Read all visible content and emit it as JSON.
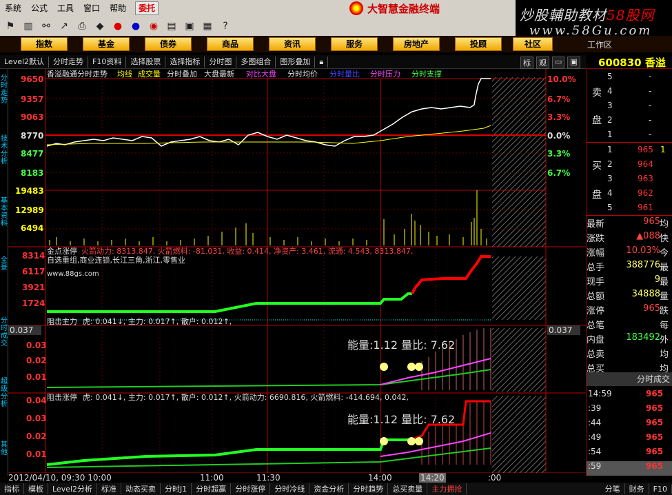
{
  "menu": {
    "items": [
      "系统",
      "公式",
      "工具",
      "窗口",
      "帮助"
    ],
    "special": "委托"
  },
  "brand": {
    "title": "大智慧金融终端"
  },
  "watermark": {
    "line1_a": "炒股輔助教材",
    "line1_b": "58股网",
    "line2": "www.58Gu.com"
  },
  "nav": {
    "buttons": [
      "指数",
      "基金",
      "债券",
      "商品",
      "资讯",
      "服务",
      "房地产",
      "投顾",
      "社区"
    ],
    "workzone": "工作区"
  },
  "subbar": {
    "items": [
      "Level2默认",
      "分时走势",
      "F10资料",
      "选择股票",
      "选择指标",
      "分时图",
      "多图组合",
      "图形叠加"
    ],
    "right": [
      "标",
      "观"
    ]
  },
  "stock": {
    "code": "600830",
    "name": "香溢"
  },
  "left_labels": [
    "分时走势",
    "技术分析",
    "基本资料",
    "全景",
    "分时成交",
    "超级分析",
    "其他"
  ],
  "main_chart": {
    "title": "香溢融通分时走势",
    "legend": [
      {
        "label": "均线",
        "color": "#ffff00"
      },
      {
        "label": "成交量",
        "color": "#ffff00"
      },
      {
        "label": "分时叠加",
        "color": "#dddddd"
      },
      {
        "label": "大盘最新",
        "color": "#dddddd"
      },
      {
        "label": "对比大盘",
        "color": "#ff44ff"
      },
      {
        "label": "分时均价",
        "color": "#dddddd"
      },
      {
        "label": "分时量比",
        "color": "#4444ff"
      },
      {
        "label": "分时压力",
        "color": "#ff44ff"
      },
      {
        "label": "分时支撑",
        "color": "#44ff44"
      }
    ],
    "y_left": [
      "9650",
      "9357",
      "9063",
      "8770",
      "8477",
      "8183"
    ],
    "y_right": [
      "10.0%",
      "6.7%",
      "3.3%",
      "0.0%",
      "3.3%",
      "6.7%"
    ],
    "vol_left": [
      "19483",
      "12989",
      "6494"
    ]
  },
  "panel2": {
    "title": "金点涨停",
    "fields": "火箭动力: 8313.847, 火箭燃料: -81.031, 收益: 0.414, 净资产: 3.461, 流通: 4.543, 8313.847,",
    "tags": "自选重组,商业连锁,长江三角,浙江,零售业",
    "url": "www.88gs.com",
    "y_left": [
      "8314",
      "6117",
      "3921",
      "1724"
    ]
  },
  "panel3": {
    "title": "阻击主力",
    "fields": "虎: 0.041↓, 主力: 0.017↑, 散户: 0.012↑,",
    "energy": "能量:1.12 量比: 7.62",
    "y_left": [
      "0.03",
      "0.02",
      "0.01"
    ],
    "badge": "0.037"
  },
  "panel4": {
    "title": "阻击涨停",
    "fields": "虎: 0.041↓, 主力: 0.017↑, 散户: 0.012↑, 火箭动力: 6690.816, 火箭燃料: -414.694, 0.042,",
    "energy": "能量:1.12 量比: 7.62",
    "y_left": [
      "0.04",
      "0.03",
      "0.02",
      "0.01"
    ]
  },
  "time_axis": [
    "2012/04/10, 09:30 10:00",
    "11:00",
    "11:30",
    "14:00",
    "14:20",
    ":00"
  ],
  "orderbook": {
    "sell_label": [
      "卖",
      "盘"
    ],
    "buy_label": [
      "买",
      "盘"
    ],
    "sell": [
      {
        "level": "5",
        "price": "",
        "vol": "-"
      },
      {
        "level": "4",
        "price": "",
        "vol": "-"
      },
      {
        "level": "3",
        "price": "",
        "vol": "-"
      },
      {
        "level": "2",
        "price": "",
        "vol": "-"
      },
      {
        "level": "1",
        "price": "",
        "vol": "-"
      }
    ],
    "buy": [
      {
        "level": "1",
        "price": "965",
        "tail": "1"
      },
      {
        "level": "2",
        "price": "964",
        "tail": ""
      },
      {
        "level": "3",
        "price": "963",
        "tail": ""
      },
      {
        "level": "4",
        "price": "962",
        "tail": ""
      },
      {
        "level": "5",
        "price": "961",
        "tail": ""
      }
    ]
  },
  "quote": [
    {
      "label": "最新",
      "value": "965",
      "color": "#ff4444",
      "tail": "均"
    },
    {
      "label": "涨跌",
      "value": "▲088",
      "color": "#ff4444",
      "tail": "快"
    },
    {
      "label": "涨幅",
      "value": "10.03%",
      "color": "#ff4444",
      "tail": "今"
    },
    {
      "label": "总手",
      "value": "388776",
      "color": "#ffff66",
      "tail": "最"
    },
    {
      "label": "现手",
      "value": "9",
      "color": "#ffff66",
      "tail": "最"
    },
    {
      "label": "总额",
      "value": "34888",
      "color": "#ffff66",
      "tail": "量"
    },
    {
      "label": "涨停",
      "value": "965",
      "color": "#ff4444",
      "tail": "跌"
    },
    {
      "label": "总笔",
      "value": "",
      "color": "#dddddd",
      "tail": "每"
    },
    {
      "label": "内盘",
      "value": "183492",
      "color": "#44ff44",
      "tail": "外"
    },
    {
      "label": "总卖",
      "value": "",
      "color": "#dddddd",
      "tail": "均"
    },
    {
      "label": "总买",
      "value": "",
      "color": "#dddddd",
      "tail": "均"
    }
  ],
  "trades_header": "分时成交",
  "trades": [
    {
      "time": "14:59",
      "price": "965"
    },
    {
      "time": ":39",
      "price": "965"
    },
    {
      "time": ":44",
      "price": "965"
    },
    {
      "time": ":49",
      "price": "965"
    },
    {
      "time": ":54",
      "price": "965"
    },
    {
      "time": ":59",
      "price": "965"
    }
  ],
  "status": [
    "指标",
    "模板",
    "Level2分析",
    "标准",
    "动态买卖",
    "分时J1",
    "分时超赢",
    "分时涨停",
    "分时冷线",
    "资金分析",
    "分时趋势",
    "总买卖量",
    "主力拥抢"
  ],
  "status_active": "主力拥抢",
  "status_right": [
    "分笔",
    "财务",
    "F10"
  ],
  "chart_data": {
    "type": "line",
    "title": "香溢融通分时走势",
    "price_series_approx": [
      8700,
      8730,
      8740,
      8720,
      8760,
      8740,
      8750,
      8770,
      8760,
      8730,
      8740,
      8760,
      8780,
      8770,
      8760,
      8720,
      8750,
      8780,
      8790,
      8800,
      8820,
      8900,
      8960,
      9000,
      9030,
      9050,
      9070,
      9100,
      9650,
      9650
    ],
    "ylim": [
      8183,
      9650
    ],
    "prev_close": 8770
  }
}
